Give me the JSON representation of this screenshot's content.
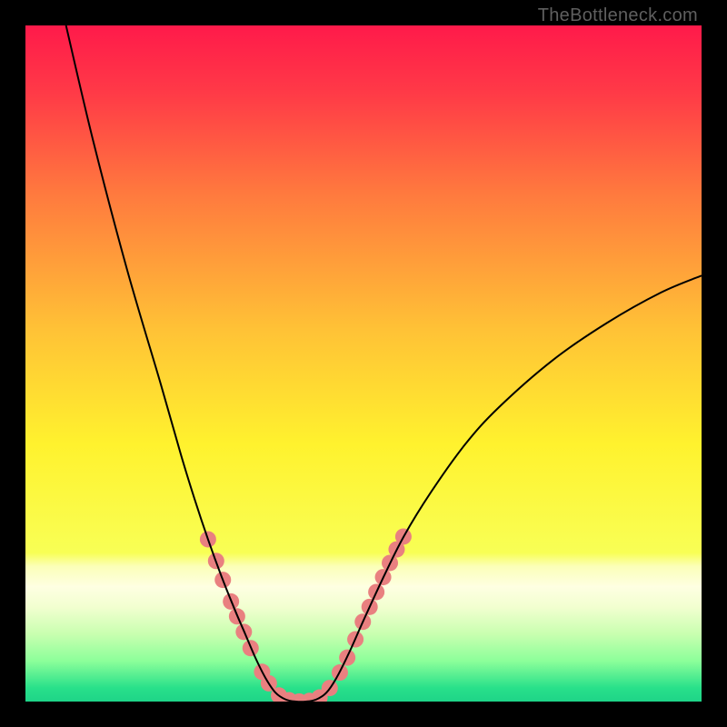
{
  "watermark": "TheBottleneck.com",
  "chart_data": {
    "type": "line",
    "title": "",
    "xlabel": "",
    "ylabel": "",
    "xlim": [
      0,
      100
    ],
    "ylim": [
      0,
      100
    ],
    "grid": false,
    "legend": false,
    "background": {
      "type": "vertical-gradient",
      "stops": [
        {
          "pos": 0.0,
          "color": "#ff1a4a"
        },
        {
          "pos": 0.1,
          "color": "#ff3a47"
        },
        {
          "pos": 0.25,
          "color": "#ff7a3e"
        },
        {
          "pos": 0.45,
          "color": "#ffc236"
        },
        {
          "pos": 0.62,
          "color": "#fff22e"
        },
        {
          "pos": 0.78,
          "color": "#f8ff55"
        },
        {
          "pos": 0.8,
          "color": "#fbffb8"
        },
        {
          "pos": 0.83,
          "color": "#feffe2"
        },
        {
          "pos": 0.86,
          "color": "#f2ffd0"
        },
        {
          "pos": 0.9,
          "color": "#c9ffb0"
        },
        {
          "pos": 0.94,
          "color": "#8cff9a"
        },
        {
          "pos": 0.98,
          "color": "#28e08a"
        },
        {
          "pos": 1.0,
          "color": "#1ed488"
        }
      ]
    },
    "series": [
      {
        "name": "bottleneck-curve",
        "stroke": "#000000",
        "stroke_width": 2,
        "points": [
          {
            "x": 6.0,
            "y": 100.0
          },
          {
            "x": 10.0,
            "y": 83.0
          },
          {
            "x": 15.0,
            "y": 64.0
          },
          {
            "x": 20.0,
            "y": 47.0
          },
          {
            "x": 23.0,
            "y": 36.5
          },
          {
            "x": 25.0,
            "y": 30.0
          },
          {
            "x": 27.0,
            "y": 24.0
          },
          {
            "x": 29.0,
            "y": 18.5
          },
          {
            "x": 31.0,
            "y": 13.5
          },
          {
            "x": 32.5,
            "y": 10.0
          },
          {
            "x": 34.0,
            "y": 6.5
          },
          {
            "x": 35.5,
            "y": 3.5
          },
          {
            "x": 37.0,
            "y": 1.3
          },
          {
            "x": 38.5,
            "y": 0.3
          },
          {
            "x": 40.0,
            "y": 0.0
          },
          {
            "x": 41.5,
            "y": 0.0
          },
          {
            "x": 43.0,
            "y": 0.3
          },
          {
            "x": 44.5,
            "y": 1.3
          },
          {
            "x": 46.0,
            "y": 3.5
          },
          {
            "x": 48.0,
            "y": 7.5
          },
          {
            "x": 50.0,
            "y": 12.0
          },
          {
            "x": 53.0,
            "y": 18.5
          },
          {
            "x": 56.0,
            "y": 24.5
          },
          {
            "x": 60.0,
            "y": 31.0
          },
          {
            "x": 65.0,
            "y": 38.0
          },
          {
            "x": 70.0,
            "y": 43.5
          },
          {
            "x": 78.0,
            "y": 50.5
          },
          {
            "x": 86.0,
            "y": 56.0
          },
          {
            "x": 94.0,
            "y": 60.5
          },
          {
            "x": 100.0,
            "y": 63.0
          }
        ]
      },
      {
        "name": "highlight-dots",
        "type": "scatter",
        "fill": "#e98080",
        "radius": 9,
        "points": [
          {
            "x": 27.0,
            "y": 24.0
          },
          {
            "x": 28.2,
            "y": 20.8
          },
          {
            "x": 29.2,
            "y": 18.0
          },
          {
            "x": 30.4,
            "y": 14.8
          },
          {
            "x": 31.3,
            "y": 12.6
          },
          {
            "x": 32.3,
            "y": 10.3
          },
          {
            "x": 33.3,
            "y": 7.9
          },
          {
            "x": 35.0,
            "y": 4.4
          },
          {
            "x": 36.0,
            "y": 2.7
          },
          {
            "x": 37.5,
            "y": 0.9
          },
          {
            "x": 39.0,
            "y": 0.2
          },
          {
            "x": 40.5,
            "y": 0.0
          },
          {
            "x": 42.0,
            "y": 0.1
          },
          {
            "x": 43.5,
            "y": 0.6
          },
          {
            "x": 45.0,
            "y": 2.0
          },
          {
            "x": 46.5,
            "y": 4.3
          },
          {
            "x": 47.6,
            "y": 6.5
          },
          {
            "x": 48.8,
            "y": 9.2
          },
          {
            "x": 49.9,
            "y": 11.8
          },
          {
            "x": 50.9,
            "y": 14.0
          },
          {
            "x": 51.9,
            "y": 16.2
          },
          {
            "x": 52.9,
            "y": 18.4
          },
          {
            "x": 53.9,
            "y": 20.5
          },
          {
            "x": 54.9,
            "y": 22.5
          },
          {
            "x": 55.9,
            "y": 24.4
          }
        ]
      }
    ]
  }
}
